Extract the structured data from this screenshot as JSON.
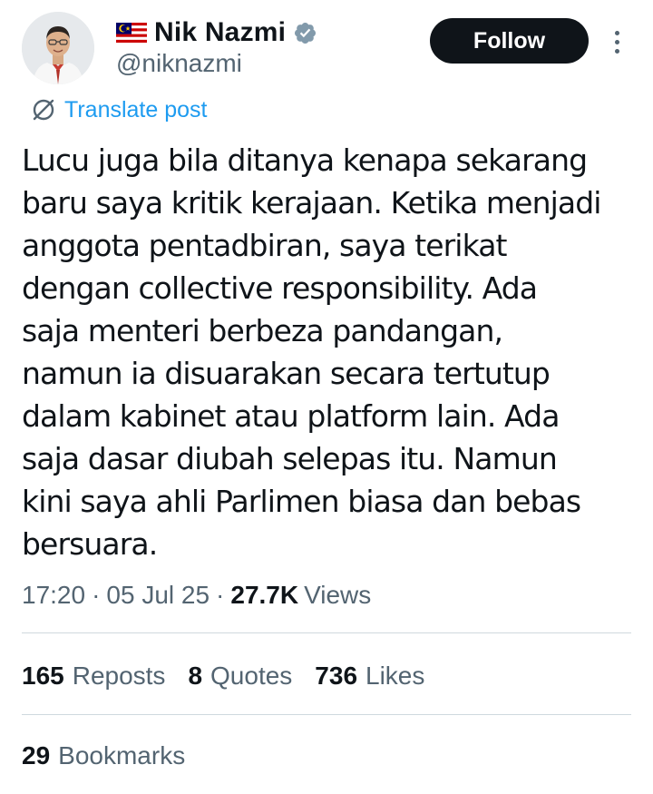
{
  "author": {
    "display_name": "Nik Nazmi",
    "handle": "@niknazmi",
    "flag_icon": "malaysia-flag-icon",
    "verified_icon": "verified-badge-icon"
  },
  "actions": {
    "follow_label": "Follow",
    "more_icon": "more-vertical-icon"
  },
  "translate": {
    "label": "Translate post",
    "icon": "translate-icon"
  },
  "post": {
    "text": "Lucu juga bila ditanya kenapa sekarang\nbaru saya kritik kerajaan. Ketika menjadi\nanggota pentadbiran, saya terikat\ndengan collective responsibility. Ada\nsaja menteri berbeza pandangan,\nnamun ia disuarakan secara tertutup\ndalam kabinet atau platform lain. Ada\nsaja dasar diubah selepas itu. Namun\nkini saya ahli Parlimen biasa dan bebas\nbersuara."
  },
  "meta": {
    "time": "17:20",
    "separator": "·",
    "date": "05 Jul 25",
    "views_count": "27.7K",
    "views_label": "Views"
  },
  "stats": {
    "reposts_count": "165",
    "reposts_label": "Reposts",
    "quotes_count": "8",
    "quotes_label": "Quotes",
    "likes_count": "736",
    "likes_label": "Likes",
    "bookmarks_count": "29",
    "bookmarks_label": "Bookmarks"
  },
  "colors": {
    "primary_text": "#0f1419",
    "secondary_text": "#536471",
    "accent": "#1d9bf0",
    "divider": "#cfd9de",
    "button_bg": "#0f1419"
  }
}
